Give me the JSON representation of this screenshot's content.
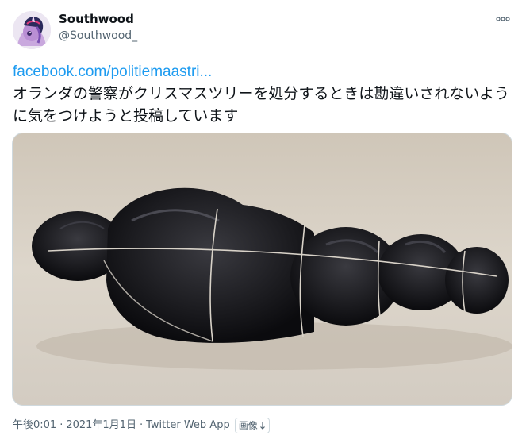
{
  "author": {
    "name": "Southwood",
    "handle": "@Southwood_",
    "avatar_icon": "avatar-pony-icon"
  },
  "tweet": {
    "link_text": "facebook.com/politiemaastri...",
    "text": "オランダの警察がクリスマスツリーを処分するときは勘違いされないように気をつけようと投稿しています"
  },
  "media": {
    "image_icon": "photo-bagged-tree"
  },
  "meta": {
    "time": "午後0:01",
    "separator": "·",
    "date": "2021年1月1日",
    "app": "Twitter Web App",
    "image_label": "画像",
    "image_label_icon": "info-arrow-icon"
  },
  "icons": {
    "more": "more-dots-icon"
  },
  "colors": {
    "link": "#1d9bf0",
    "text": "#0f1419",
    "secondary": "#536471",
    "border": "#cfd9de"
  }
}
